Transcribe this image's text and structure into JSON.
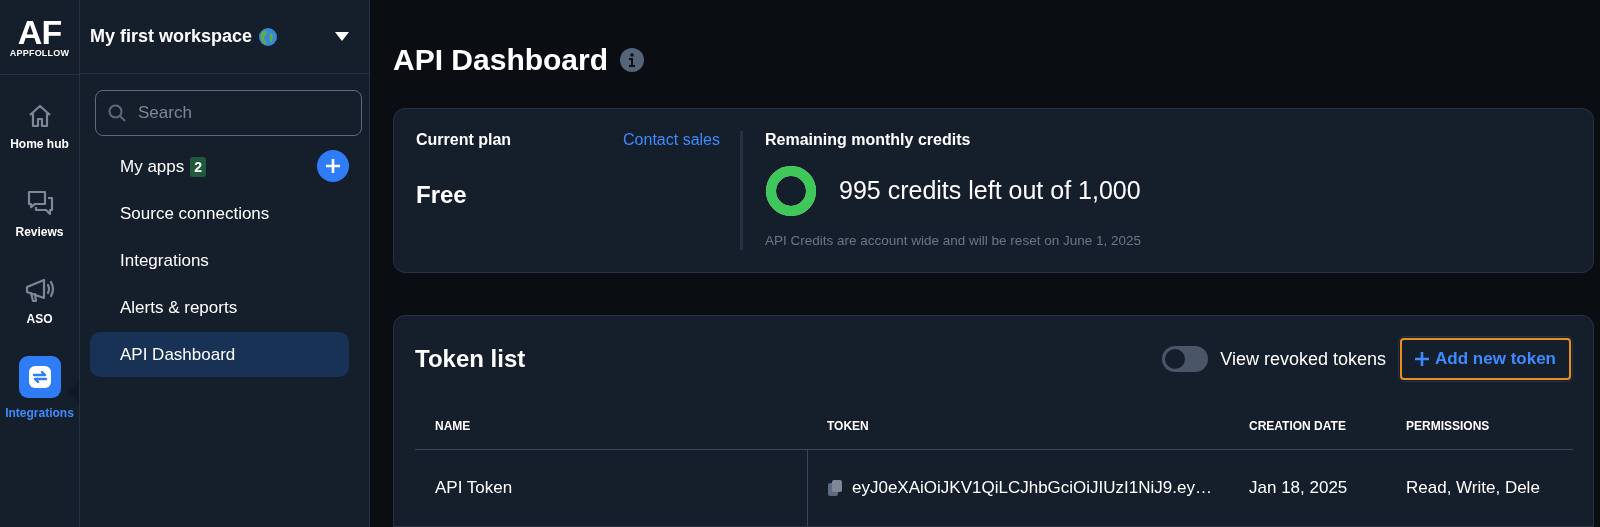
{
  "logo": {
    "mark": "AF",
    "name": "APPFOLLOW"
  },
  "rail": [
    {
      "label": "Home hub",
      "kind": "home",
      "selected": false
    },
    {
      "label": "Reviews",
      "kind": "reviews",
      "selected": false
    },
    {
      "label": "ASO",
      "kind": "aso",
      "selected": false
    },
    {
      "label": "Integrations",
      "kind": "integrations",
      "selected": true
    }
  ],
  "workspace": {
    "title": "My first workspace"
  },
  "sidebar": {
    "search": {
      "placeholder": "Search"
    },
    "items": [
      {
        "label": "My apps",
        "badge": "2",
        "add": true,
        "selected": false
      },
      {
        "label": "Source connections",
        "selected": false
      },
      {
        "label": "Integrations",
        "selected": false
      },
      {
        "label": "Alerts & reports",
        "selected": false
      },
      {
        "label": "API Dashboard",
        "selected": true
      }
    ]
  },
  "page": {
    "title": "API Dashboard"
  },
  "plan": {
    "label": "Current plan",
    "link": "Contact sales",
    "value": "Free"
  },
  "credits": {
    "label": "Remaining monthly credits",
    "summary": "995 credits left out of 1,000",
    "note": "API Credits are account wide and will be reset on June 1, 2025"
  },
  "tokens": {
    "title": "Token list",
    "toggle": {
      "label": "View revoked tokens",
      "on": false
    },
    "add_button": {
      "label": "Add new token",
      "focused": true
    },
    "columns": [
      "NAME",
      "TOKEN",
      "CREATION DATE",
      "PERMISSIONS"
    ],
    "rows": [
      {
        "name": "API Token",
        "token": "eyJ0eXAiOiJKV1QiLCJhbGciOiJIUzI1NiJ9.ey…",
        "created": "Jan 18, 2025",
        "permissions": "Read, Write, Dele"
      }
    ]
  }
}
